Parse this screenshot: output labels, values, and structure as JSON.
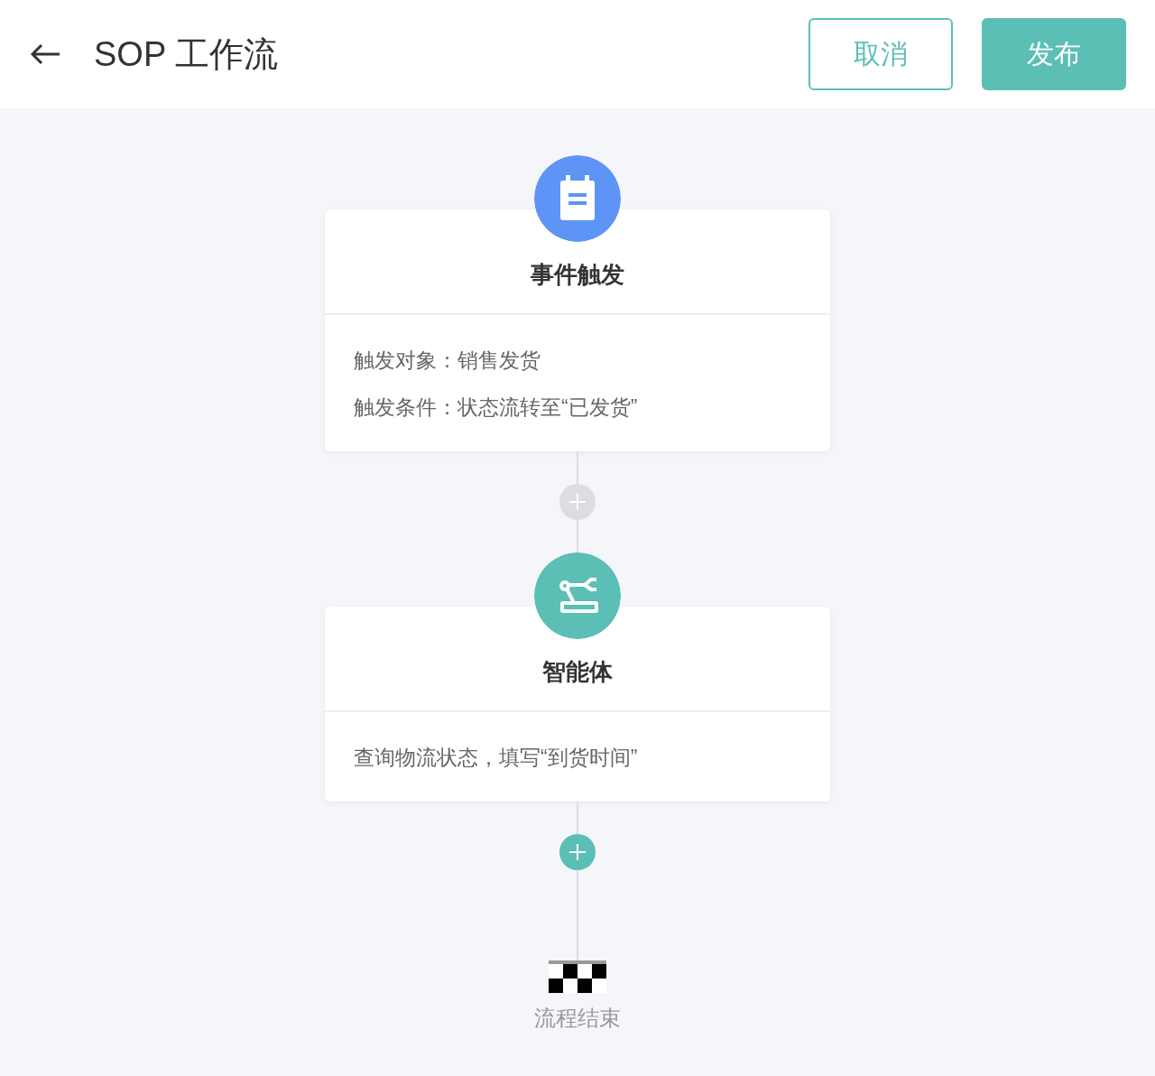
{
  "header": {
    "title": "SOP 工作流",
    "buttons": [
      {
        "label": "取消",
        "kind": "secondary"
      },
      {
        "label": "发布",
        "kind": "primary"
      }
    ]
  },
  "nodes": [
    {
      "kind": "trigger",
      "title": "事件触发",
      "lines": [
        "触发对象：销售发货",
        "触发条件：状态流转至“已发货”"
      ],
      "add_button": {
        "disabled": true
      }
    },
    {
      "kind": "agent",
      "title": "智能体",
      "lines": [
        "查询物流状态，填写“到货时间”"
      ],
      "add_button": {
        "disabled": false
      }
    }
  ],
  "end": {
    "label": "流程结束"
  }
}
